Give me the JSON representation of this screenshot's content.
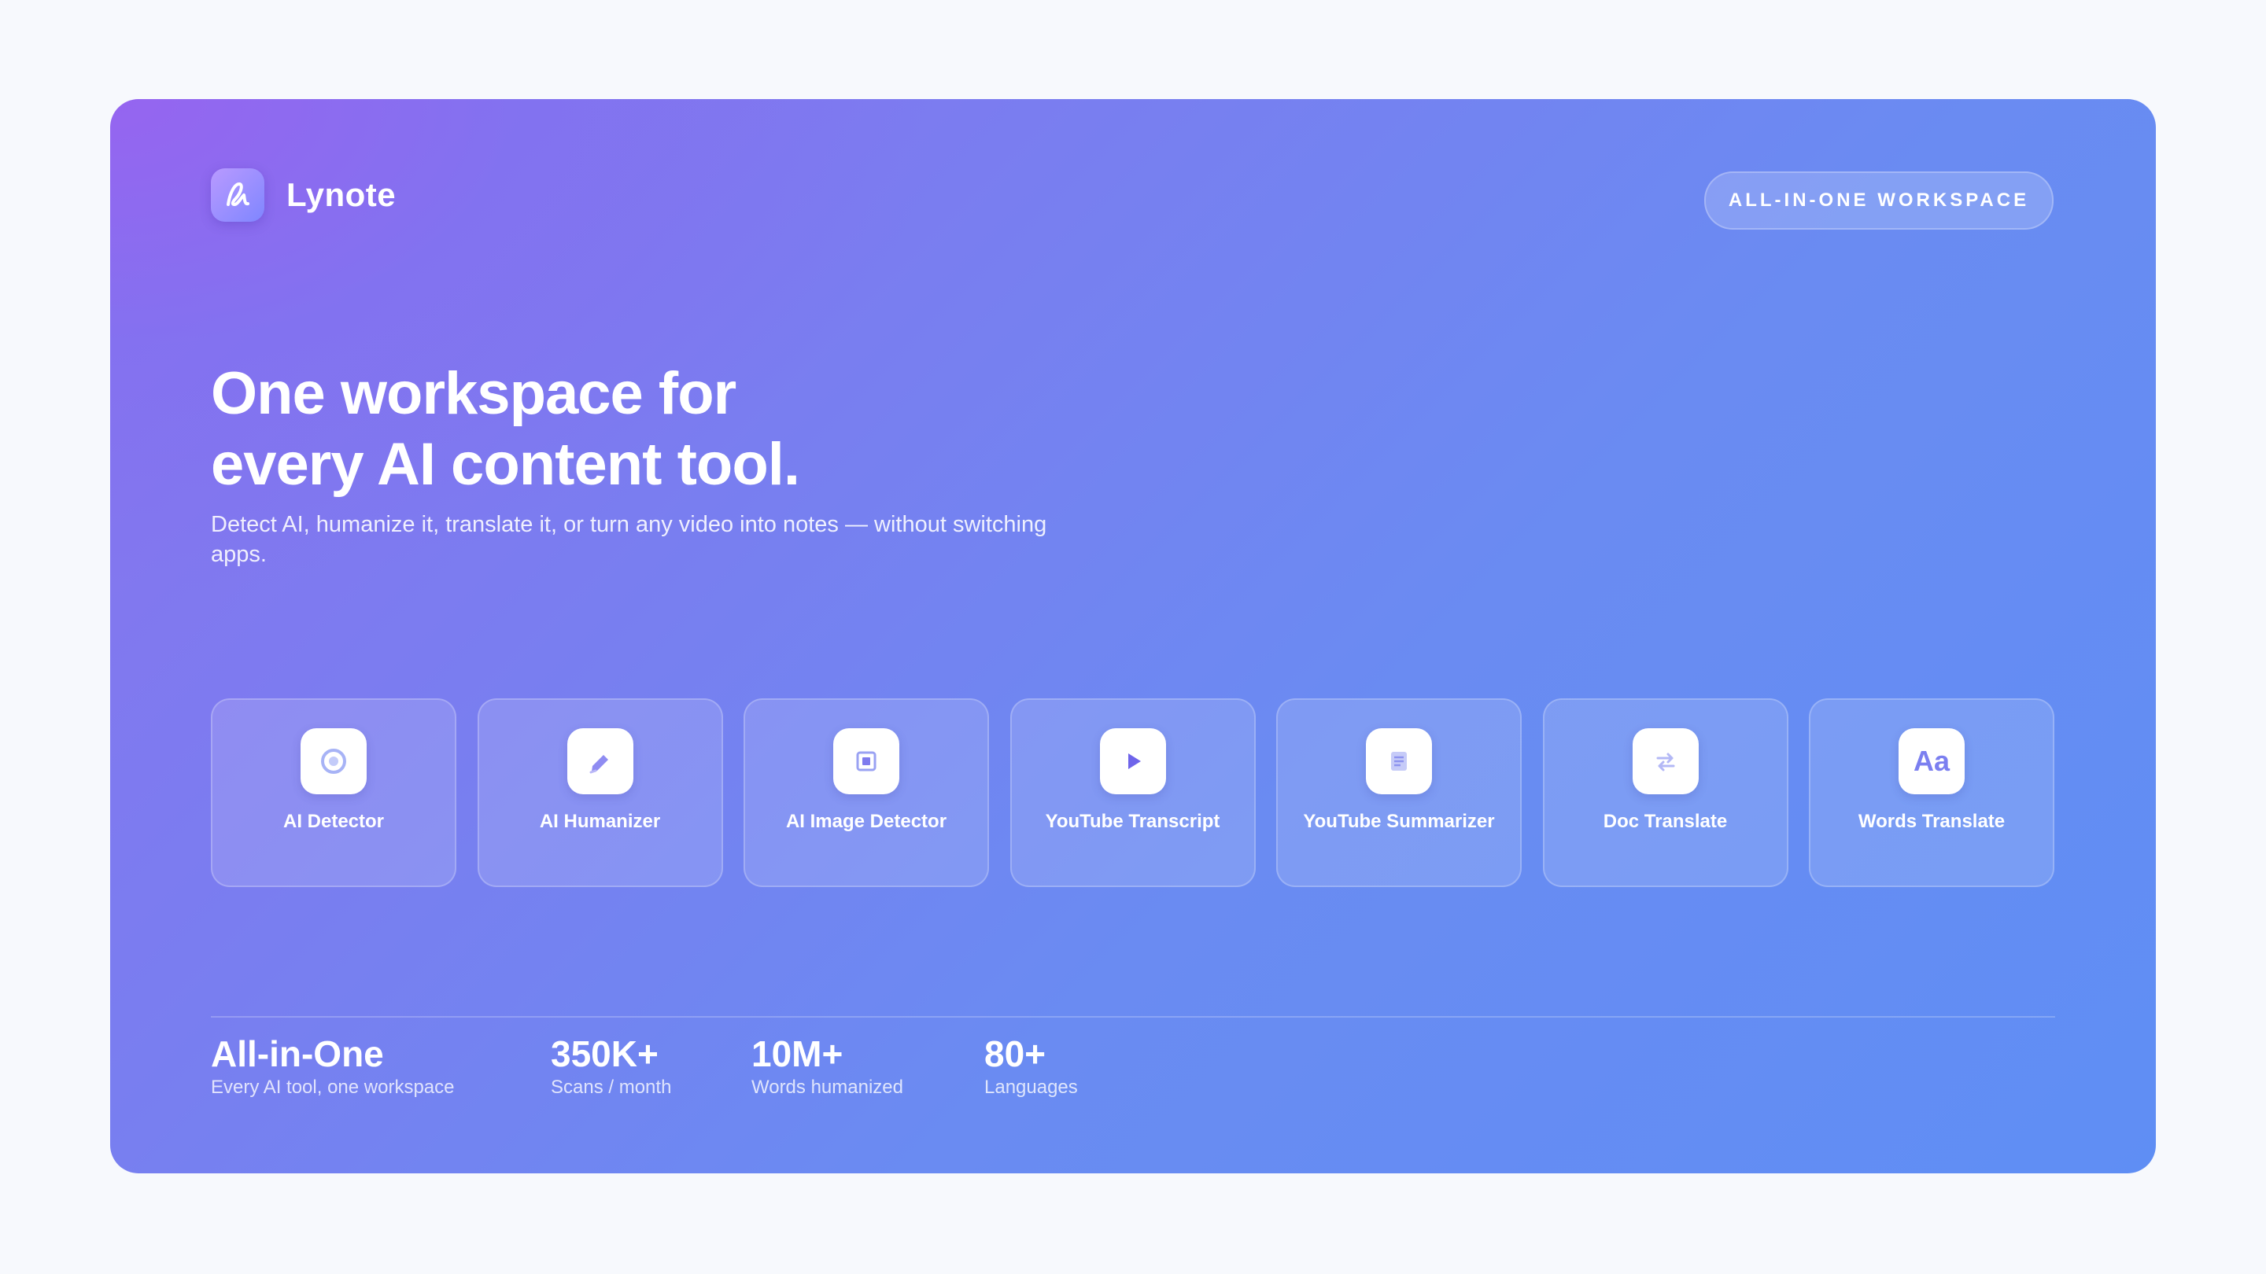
{
  "brand": {
    "name": "Lynote",
    "logo_icon": "script-l-icon"
  },
  "badge": {
    "label": "ALL-IN-ONE WORKSPACE"
  },
  "hero": {
    "headline_line1": "One workspace for",
    "headline_line2": "every AI content tool.",
    "subline": "Detect AI, humanize it, translate it, or turn any video into notes — without switching apps."
  },
  "tools": [
    {
      "label": "AI Detector",
      "icon": "shield-icon",
      "glyph": ""
    },
    {
      "label": "AI Humanizer",
      "icon": "pen-icon",
      "glyph": ""
    },
    {
      "label": "AI Image Detector",
      "icon": "image-frame-icon",
      "glyph": ""
    },
    {
      "label": "YouTube Transcript",
      "icon": "play-icon",
      "glyph": ""
    },
    {
      "label": "YouTube Summarizer",
      "icon": "document-icon",
      "glyph": ""
    },
    {
      "label": "Doc Translate",
      "icon": "swap-arrows-icon",
      "glyph": ""
    },
    {
      "label": "Words Translate",
      "icon": "text-aa-icon",
      "glyph": "Aa"
    }
  ],
  "stats": [
    {
      "value": "All-in-One",
      "label": "Every AI tool, one workspace"
    },
    {
      "value": "350K+",
      "label": "Scans / month"
    },
    {
      "value": "10M+",
      "label": "Words humanized"
    },
    {
      "value": "80+",
      "label": "Languages"
    }
  ],
  "colors": {
    "gradient_start": "#8a72ee",
    "gradient_end": "#5f8ef4",
    "icon_accent": "#7b7ff0"
  }
}
